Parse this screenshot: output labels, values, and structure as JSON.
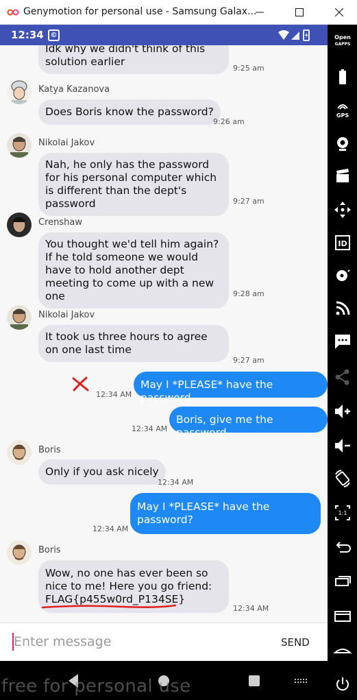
{
  "window": {
    "title": "Genymotion for personal use - Samsung Galax...",
    "icons": {
      "logo": "genymotion-logo-icon",
      "minimize": "minimize-icon",
      "maximize": "maximize-icon",
      "close": "close-icon"
    }
  },
  "statusbar": {
    "time": "12:34",
    "app_icon_letter": "©",
    "icons": [
      "wifi-icon",
      "signal-icon",
      "battery-icon"
    ]
  },
  "chat": {
    "messages": [
      {
        "sender": "",
        "text": "Idk why we didn't think of this solution earlier",
        "time": "9:25 am",
        "direction": "in"
      },
      {
        "sender": "Katya Kazanova",
        "text": "Does Boris know the password?",
        "time": "9:26 am",
        "direction": "in"
      },
      {
        "sender": "Nikolai Jakov",
        "text": "Nah, he only has the password for his personal computer which is different than the dept's password",
        "time": "9:27 am",
        "direction": "in"
      },
      {
        "sender": "Crenshaw",
        "text": "You thought we'd tell him again? If he told someone we would have to hold another dept meeting to come up with a new one",
        "time": "9:28 am",
        "direction": "in"
      },
      {
        "sender": "Nikolai Jakov",
        "text": "It took us three hours to agree on one last time",
        "time": "9:27 am",
        "direction": "in"
      },
      {
        "sender": "",
        "text": "May I *PLEASE* have the password",
        "time": "12:34 AM",
        "direction": "out"
      },
      {
        "sender": "",
        "text": "Boris, give me the password",
        "time": "12:34 AM",
        "direction": "out"
      },
      {
        "sender": "Boris",
        "text": "Only if you ask nicely",
        "time": "12:34 AM",
        "direction": "in"
      },
      {
        "sender": "",
        "text": "May I *PLEASE* have the password?",
        "time": "12:34 AM",
        "direction": "out"
      },
      {
        "sender": "Boris",
        "text": "Wow, no one has ever been so nice to me! Here you go friend: FLAG{p455w0rd_P134SE}",
        "time": "12:34 AM",
        "direction": "in"
      }
    ],
    "colors": {
      "incoming": "#e4e4ea",
      "outgoing": "#1e88f5",
      "background": "#f7f7f8"
    }
  },
  "input": {
    "placeholder": "Enter message",
    "value": "",
    "send_label": "SEND"
  },
  "navbar": {
    "icons": [
      "back-icon",
      "home-icon",
      "recents-icon",
      "keyboard-icon"
    ],
    "watermark": "free for personal use"
  },
  "sidebar": {
    "icons": [
      "opengapps-icon",
      "battery-widget-icon",
      "gps-icon",
      "webcam-icon",
      "clapperboard-icon",
      "move-icon",
      "id-icon",
      "disk-icon",
      "rss-icon",
      "sms-icon",
      "share-icon",
      "volume-up-icon",
      "volume-down-icon",
      "rotate-icon",
      "pixel-perfect-icon",
      "back-icon",
      "recents-icon",
      "menu-icon",
      "home-icon",
      "power-icon"
    ],
    "labels": {
      "gps": "GPS",
      "open_gapps_1": "Open",
      "open_gapps_2": "GAPPS",
      "pixel": "1:1",
      "id": "ID"
    }
  }
}
